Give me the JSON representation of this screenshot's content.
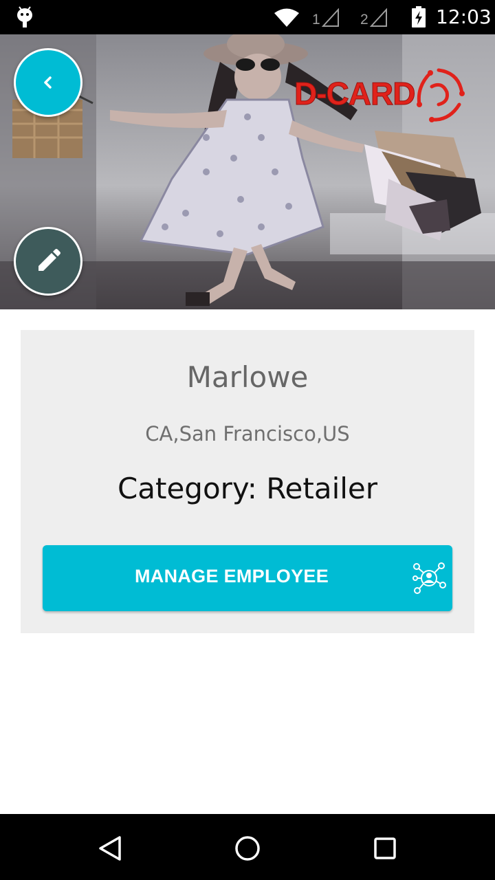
{
  "status_bar": {
    "time": "12:03",
    "sim1_label": "1",
    "sim2_label": "2",
    "icons": [
      "android-icon",
      "wifi-icon",
      "signal-icon",
      "signal-icon",
      "battery-charging-icon"
    ]
  },
  "banner": {
    "logo_text": "D-CARD",
    "back_icon": "chevron-left-icon",
    "edit_icon": "pencil-icon"
  },
  "profile": {
    "name": "Marlowe",
    "location": "CA,San Francisco,US",
    "category_label": "Category:",
    "category_value": "Retailer"
  },
  "actions": {
    "manage_employee_label": "MANAGE EMPLOYEE",
    "manage_employee_icon": "employee-network-icon"
  },
  "nav_bar": {
    "icons": [
      "back-triangle-icon",
      "home-circle-icon",
      "recents-square-icon"
    ]
  },
  "colors": {
    "accent": "#00bcd4",
    "edit_fab": "#3e5b5b",
    "card_bg": "#eeeeee",
    "logo_red": "#e0221b"
  }
}
